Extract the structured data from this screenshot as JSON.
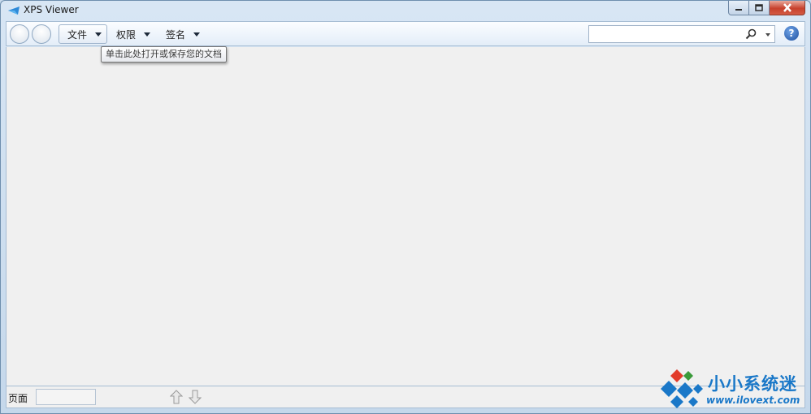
{
  "window": {
    "title": "XPS Viewer"
  },
  "toolbar": {
    "file_label": "文件",
    "permissions_label": "权限",
    "signatures_label": "签名",
    "search_placeholder": ""
  },
  "tooltip": {
    "text": "单击此处打开或保存您的文档"
  },
  "statusbar": {
    "page_label": "页面",
    "page_value": ""
  },
  "help": {
    "label": "?"
  },
  "watermark": {
    "title": "小小系统迷",
    "url": "www.ilovext.com"
  }
}
